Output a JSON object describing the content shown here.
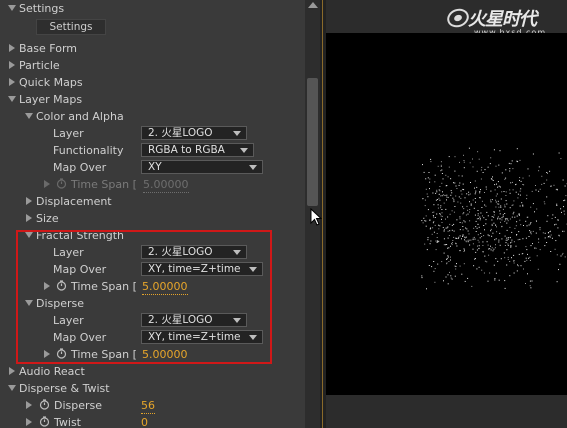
{
  "panel": {
    "top_section": {
      "label": "Settings",
      "button_label": "Settings"
    },
    "groups": [
      {
        "label": "Base Form"
      },
      {
        "label": "Particle"
      },
      {
        "label": "Quick Maps"
      },
      {
        "label": "Layer Maps"
      }
    ],
    "color_alpha": {
      "label": "Color and Alpha",
      "layer_label": "Layer",
      "layer_value": "2. 火星LOGO",
      "func_label": "Functionality",
      "func_value": "RGBA to RGBA",
      "mapover_label": "Map Over",
      "mapover_value": "XY",
      "timespan_label": "Time Span [",
      "timespan_value": "5.00000"
    },
    "displacement": {
      "label": "Displacement"
    },
    "size": {
      "label": "Size"
    },
    "fractal": {
      "label": "Fractal Strength",
      "layer_label": "Layer",
      "layer_value": "2. 火星LOGO",
      "mapover_label": "Map Over",
      "mapover_value": "XY, time=Z+time",
      "timespan_label": "Time Span [",
      "timespan_value": "5.00000"
    },
    "disperse": {
      "label": "Disperse",
      "layer_label": "Layer",
      "layer_value": "2. 火星LOGO",
      "mapover_label": "Map Over",
      "mapover_value": "XY, time=Z+time",
      "timespan_label": "Time Span [",
      "timespan_value": "5.00000"
    },
    "audio_react": {
      "label": "Audio React"
    },
    "disperse_twist": {
      "label": "Disperse & Twist",
      "disperse_label": "Disperse",
      "disperse_value": "56",
      "twist_label": "Twist",
      "twist_value": "0"
    }
  },
  "watermark": {
    "brand": "火星时代",
    "url": "www.hxsd.com"
  },
  "colors": {
    "highlight": "#d01818",
    "value_accent": "#e6a52a",
    "panel_bg": "#3a3a3a"
  }
}
